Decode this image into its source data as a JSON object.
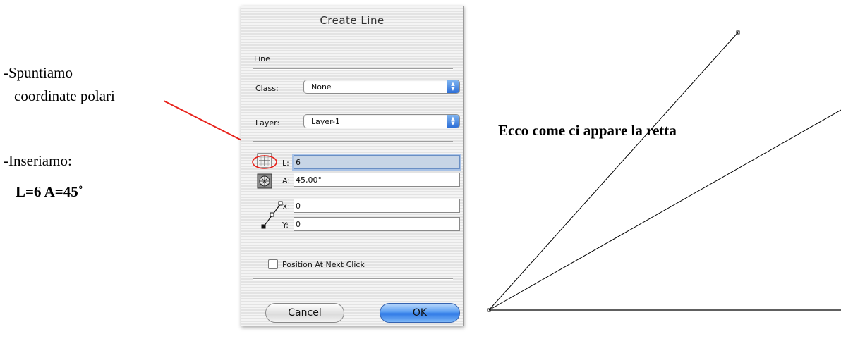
{
  "annotations": {
    "step1_line1": "-Spuntiamo",
    "step1_line2": "coordinate polari",
    "step2_line1": "-Inseriamo:",
    "step2_line2": "L=6 A=45˚",
    "result_caption": "Ecco come ci appare la retta"
  },
  "dialog": {
    "title": "Create Line",
    "group_label": "Line",
    "class_label": "Class:",
    "class_value": "None",
    "layer_label": "Layer:",
    "layer_value": "Layer-1",
    "length_label": "L:",
    "length_value": "6",
    "angle_label": "A:",
    "angle_value": "45,00°",
    "x_label": "X:",
    "x_value": "0",
    "y_label": "Y:",
    "y_value": "0",
    "position_checkbox_label": "Position At Next Click",
    "position_checkbox_checked": false,
    "cancel_label": "Cancel",
    "ok_label": "OK"
  },
  "colors": {
    "annotation_arrow": "#e8231c",
    "ok_button": "#4a90ea",
    "drawing_lines": "#000000"
  }
}
